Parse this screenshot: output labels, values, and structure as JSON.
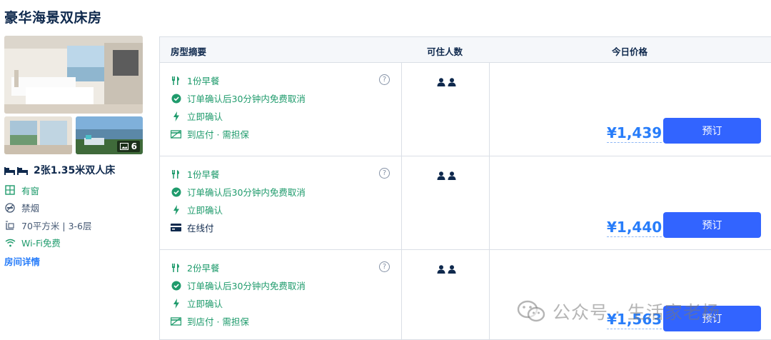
{
  "room": {
    "title": "豪华海景双床房",
    "photo_count": "6",
    "bed": "2张1.35米双人床",
    "amenities": [
      "有窗",
      "禁烟",
      "70平方米 | 3-6层",
      "Wi-Fi免费"
    ],
    "detail_link": "房间详情"
  },
  "table": {
    "headers": {
      "summary": "房型摘要",
      "guests": "可住人数",
      "price": "今日价格"
    },
    "rows": [
      {
        "breakfast": "1份早餐",
        "cancel": "订单确认后30分钟内免费取消",
        "confirm": "立即确认",
        "payment": "到店付 · 需担保",
        "payment_type": "hotel",
        "currency": "¥",
        "price": "1,439",
        "book": "预订"
      },
      {
        "breakfast": "1份早餐",
        "cancel": "订单确认后30分钟内免费取消",
        "confirm": "立即确认",
        "payment": "在线付",
        "payment_type": "online",
        "currency": "¥",
        "price": "1,440",
        "book": "预订"
      },
      {
        "breakfast": "2份早餐",
        "cancel": "订单确认后30分钟内免费取消",
        "confirm": "立即确认",
        "payment": "到店付 · 需担保",
        "payment_type": "hotel",
        "currency": "¥",
        "price": "1,563",
        "book": "预订"
      }
    ]
  },
  "watermark": "公众号 · 生活家老杨",
  "colors": {
    "green": "#1f9b6c",
    "blue_price": "#287dfa",
    "button": "#3264ff",
    "text": "#0f294d"
  }
}
